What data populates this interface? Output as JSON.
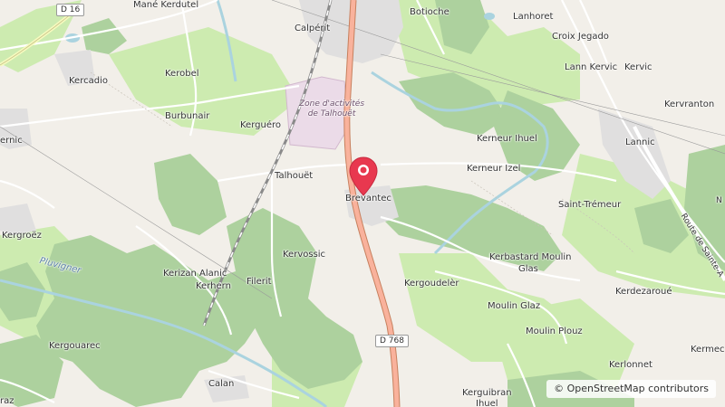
{
  "map": {
    "places": {
      "mane_kerdutel": "Mané Kerdutel",
      "calperit": "Calpérit",
      "botioche": "Botioche",
      "lanhoret": "Lanhoret",
      "croix_jegado": "Croix Jegado",
      "lann_kervic": "Lann Kervic",
      "kervic": "Kervic",
      "kercadio": "Kercadio",
      "kerobel": "Kerobel",
      "burbunair": "Burbunair",
      "kernic": "ernic",
      "kerguero": "Kerguéro",
      "kerneur_ihuel": "Kerneur Ihuel",
      "kervranton": "Kervranton",
      "lannic": "Lannic",
      "talhouet": "Talhouët",
      "kerneur_izel": "Kerneur Izel",
      "brevantec": "Brevantec",
      "saint_tremeur": "Saint-Trémeur",
      "kergroez": "Kergroëz",
      "kervossic": "Kervossic",
      "kerbastard_1": "Kerbastard Moulin",
      "kerbastard_2": "Glas",
      "kerizan_alanic": "Kerizan Alanic",
      "kerhern": "Kerhern",
      "filerit": "Filerit",
      "kergoudeler": "Kergoudelèr",
      "kerdezaroue": "Kerdezaroué",
      "moulin_glaz": "Moulin Glaz",
      "kergouarec": "Kergouarec",
      "moulin_plouz": "Moulin Plouz",
      "kermec": "Kermec",
      "kerlonnet": "Kerlonnet",
      "calan": "Calan",
      "kerguibran_1": "Kerguibran",
      "kerguibran_2": "Ihuel",
      "raz": "raz"
    },
    "zone_line1": "Zone d'activités",
    "zone_line2": "de Talhouët",
    "river_pluvigner": "Pluvigner",
    "road_sainte": "Route de Sainte-A",
    "road_n_initial": "N",
    "road_d16": "D 16",
    "road_d768": "D 768",
    "marker": "Brevantec",
    "attribution": "© OpenStreetMap contributors",
    "colors": {
      "background": "#f2efe9",
      "forest": "#add19e",
      "meadow": "#cdebb0",
      "industrial": "#ebdbe8",
      "residential": "#e0dfdf",
      "trunk_road": "#f9b29c",
      "water": "#aad3df",
      "marker": "#e8384f"
    }
  }
}
